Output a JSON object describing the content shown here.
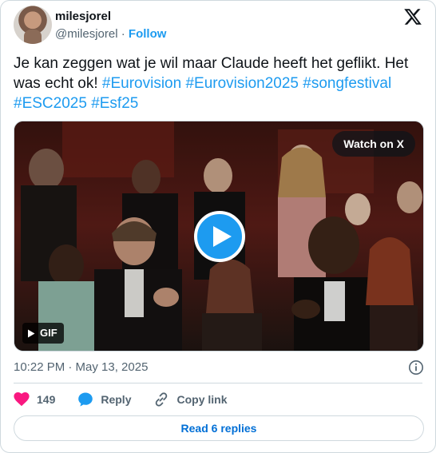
{
  "author": {
    "display_name": "milesjorel",
    "handle": "@milesjorel",
    "separator": "·",
    "follow_label": "Follow"
  },
  "tweet": {
    "text_plain": "Je kan zeggen wat je wil maar Claude heeft het geflikt. Het was echt ok! ",
    "hashtags": [
      "#Eurovision",
      "#Eurovision2025",
      "#songfestival",
      "#ESC2025",
      "#Esf25"
    ]
  },
  "media": {
    "watch_label": "Watch on X",
    "gif_label": "GIF"
  },
  "meta": {
    "timestamp": "10:22 PM · May 13, 2025"
  },
  "actions": {
    "like_count": "149",
    "reply_label": "Reply",
    "copy_link_label": "Copy link"
  },
  "read_replies_label": "Read 6 replies",
  "colors": {
    "accent": "#1d9bf0",
    "like_heart": "#f91880",
    "reply_link": "#006fd6"
  }
}
